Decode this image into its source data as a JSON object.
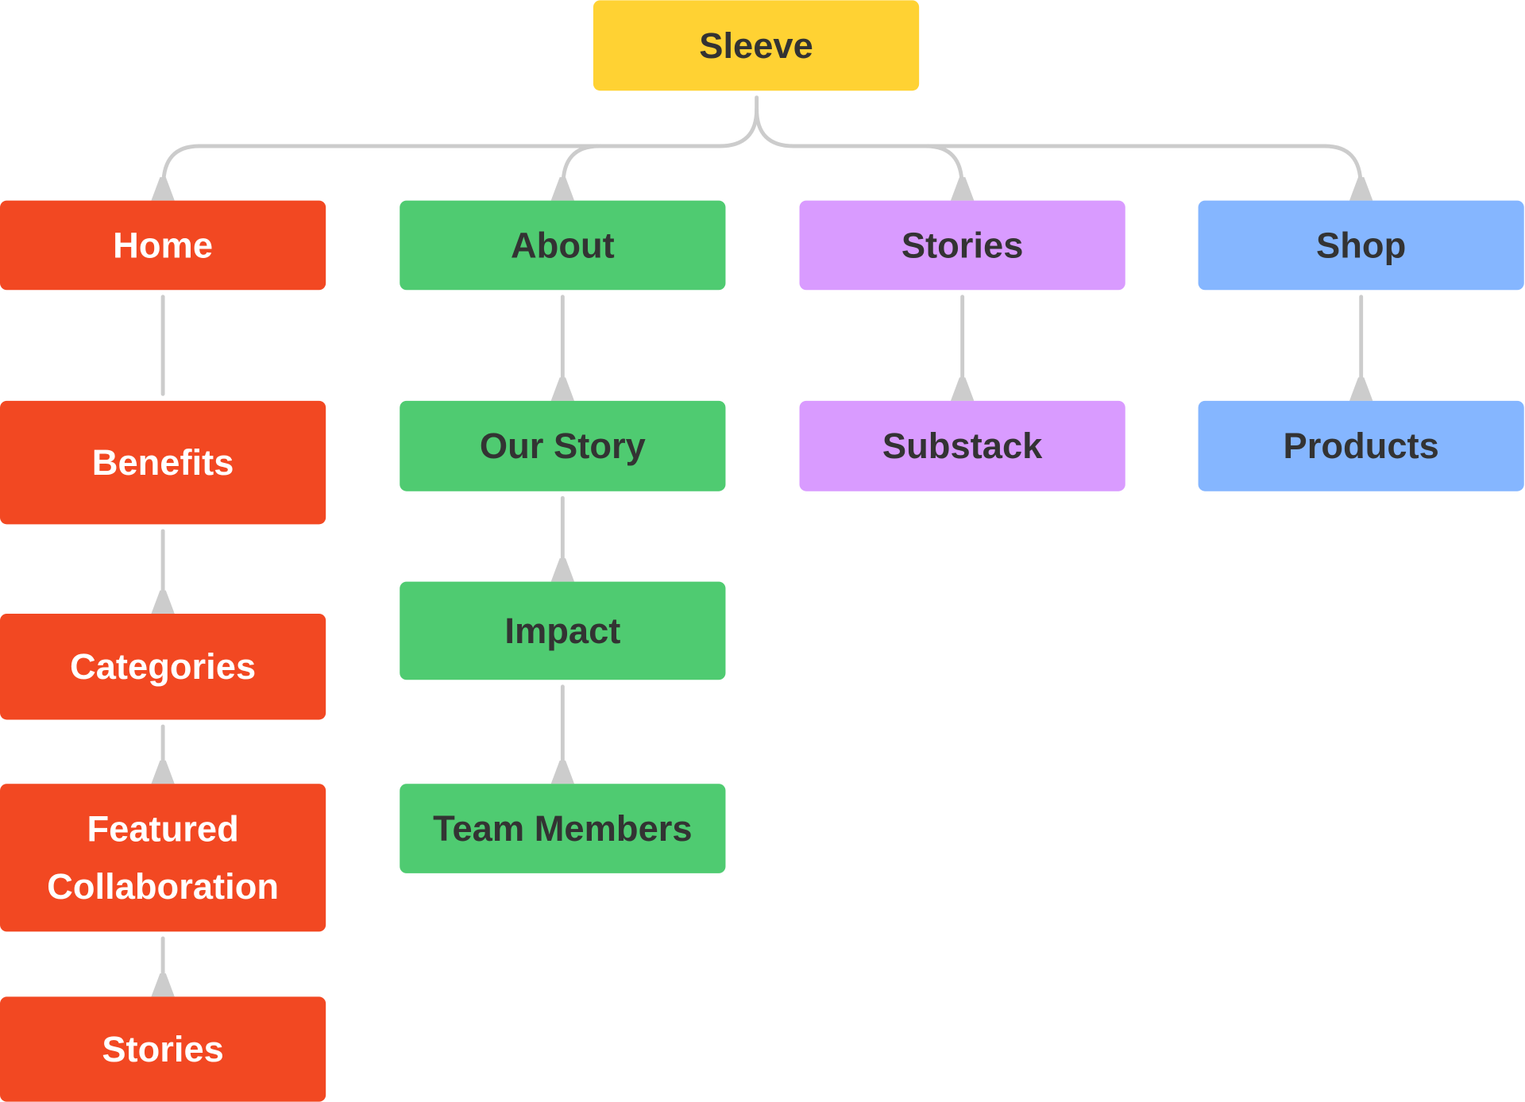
{
  "diagram": {
    "connector_color": "#cccccc",
    "root": {
      "label": "Sleeve",
      "color": "#FFD233",
      "text_color": "#333333"
    },
    "columns": [
      {
        "color": "#F24822",
        "text_color": "#ffffff",
        "nodes": [
          {
            "label": "Home"
          },
          {
            "label": "Benefits"
          },
          {
            "label": "Categories"
          },
          {
            "label": "Featured",
            "label2": "Collaboration"
          },
          {
            "label": "Stories"
          }
        ]
      },
      {
        "color": "#4FCB71",
        "text_color": "#333333",
        "nodes": [
          {
            "label": "About"
          },
          {
            "label": "Our Story"
          },
          {
            "label": "Impact"
          },
          {
            "label": "Team Members"
          }
        ]
      },
      {
        "color": "#D99BFF",
        "text_color": "#333333",
        "nodes": [
          {
            "label": "Stories"
          },
          {
            "label": "Substack"
          }
        ]
      },
      {
        "color": "#85B6FF",
        "text_color": "#333333",
        "nodes": [
          {
            "label": "Shop"
          },
          {
            "label": "Products"
          }
        ]
      }
    ]
  }
}
